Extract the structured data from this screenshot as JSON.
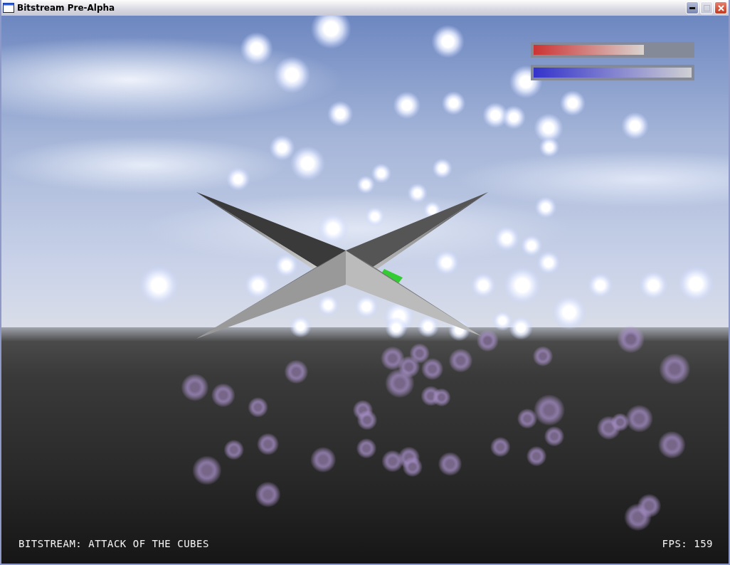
{
  "window": {
    "title": "Bitstream Pre-Alpha"
  },
  "hud": {
    "bars": [
      {
        "kind": "health",
        "level": 0.7
      },
      {
        "kind": "energy",
        "level": 1
      }
    ]
  },
  "footer": {
    "game_title": "BITSTREAM: ATTACK OF THE CUBES",
    "fps": "FPS: 159"
  }
}
